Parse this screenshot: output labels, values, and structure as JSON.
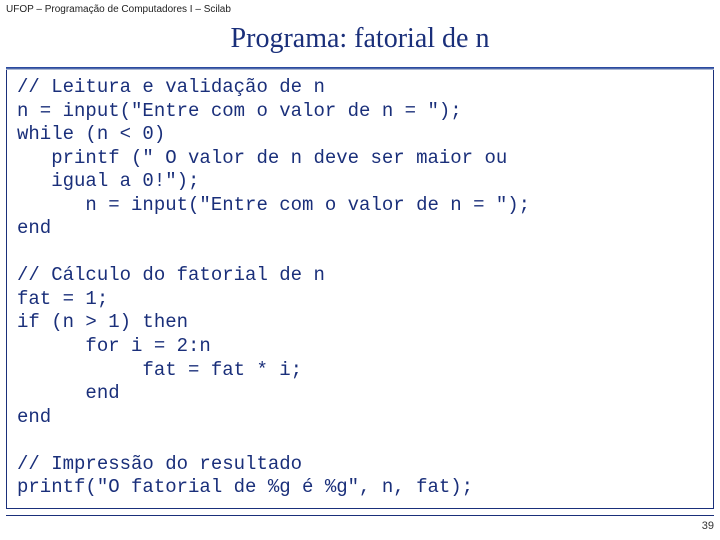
{
  "header": "UFOP – Programação de Computadores I – Scilab",
  "title": "Programa: fatorial de n",
  "code": "// Leitura e validação de n\nn = input(\"Entre com o valor de n = \");\nwhile (n < 0)\n   printf (\" O valor de n deve ser maior ou\n   igual a 0!\");\n      n = input(\"Entre com o valor de n = \");\nend\n\n// Cálculo do fatorial de n\nfat = 1;\nif (n > 1) then\n      for i = 2:n\n           fat = fat * i;\n      end\nend\n\n// Impressão do resultado\nprintf(\"O fatorial de %g é %g\", n, fat);",
  "page_number": "39"
}
